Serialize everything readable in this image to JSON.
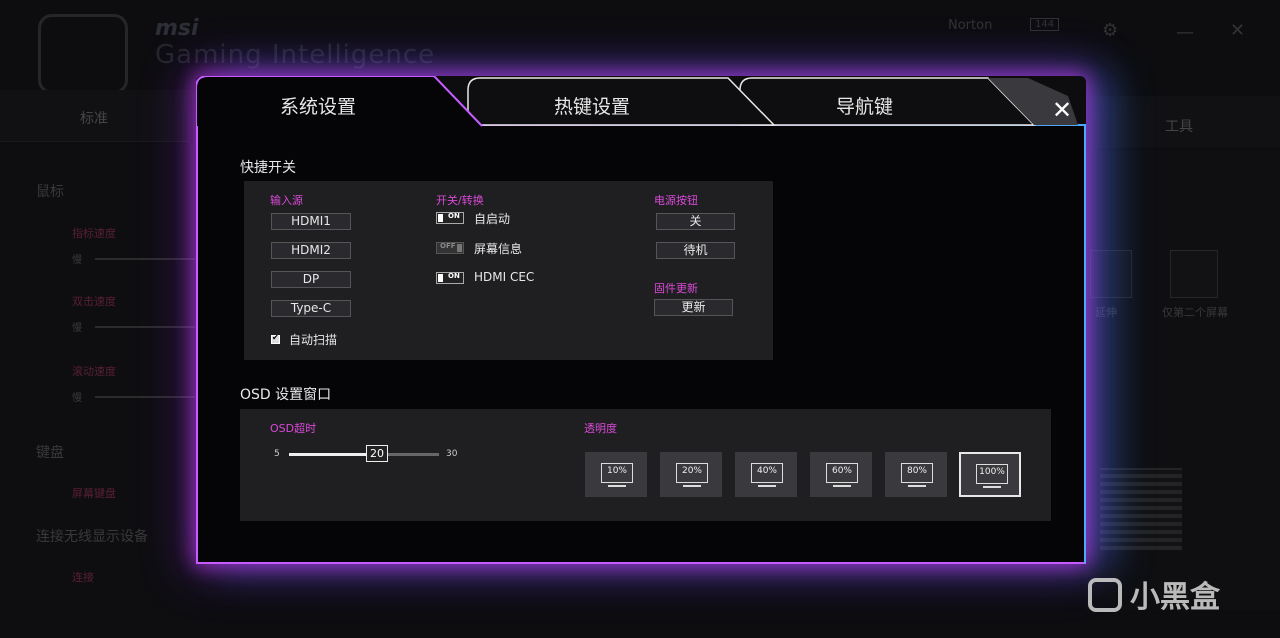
{
  "background": {
    "brand": "msi",
    "subtitle": "Gaming Intelligence",
    "norton": "Norton",
    "hz": "144",
    "left_tab": "标准",
    "right_tab": "工具",
    "mouse": "鼠标",
    "pointer_speed": "指标速度",
    "double_click": "双击速度",
    "scroll_speed": "滚动速度",
    "slow": "慢",
    "keyboard": "键盘",
    "repeat_delay": "屏幕键盘",
    "wireless": "连接无线显示设备",
    "connect": "连接",
    "extend": "延伸",
    "second_only": "仅第二个屏幕"
  },
  "modal": {
    "tabs": [
      {
        "label": "系统设置"
      },
      {
        "label": "热键设置"
      },
      {
        "label": "导航键"
      }
    ],
    "close_icon": "✕",
    "quick_switch": {
      "title": "快捷开关",
      "input_source": {
        "label": "输入源",
        "options": [
          "HDMI1",
          "HDMI2",
          "DP",
          "Type-C"
        ],
        "auto_scan": "自动扫描"
      },
      "switches": {
        "label": "开关/转换",
        "items": [
          {
            "label": "自启动",
            "state": "ON"
          },
          {
            "label": "屏幕信息",
            "state": "OFF"
          },
          {
            "label": "HDMI CEC",
            "state": "ON"
          }
        ]
      },
      "power_button": {
        "label": "电源按钮",
        "options": [
          "关",
          "待机"
        ]
      },
      "firmware": {
        "label": "固件更新",
        "button": "更新"
      }
    },
    "osd": {
      "title": "OSD 设置窗口",
      "timeout": {
        "label": "OSD超时",
        "min": "5",
        "max": "30",
        "value": "20"
      },
      "transparency": {
        "label": "透明度",
        "options": [
          "10%",
          "20%",
          "40%",
          "60%",
          "80%",
          "100%"
        ],
        "selected": "100%"
      }
    }
  },
  "watermark": "小黑盒",
  "colors": {
    "accent_label": "#d94ad6",
    "glow_purple": "#c45cff",
    "glow_blue": "#4aa8ff"
  }
}
